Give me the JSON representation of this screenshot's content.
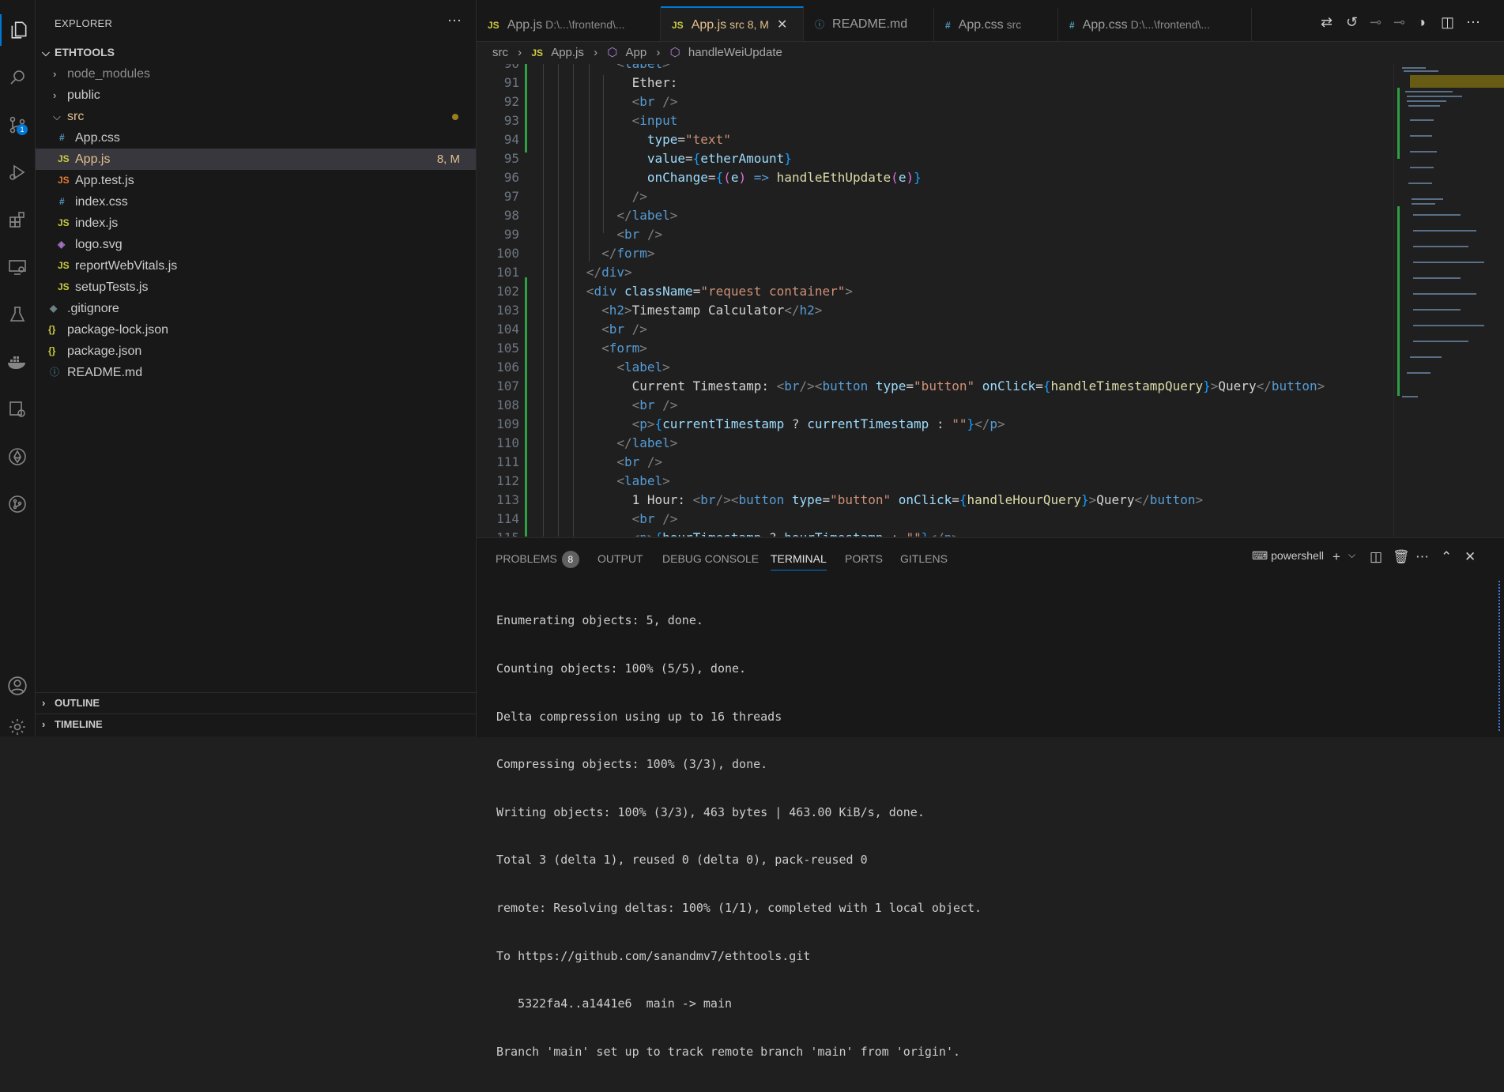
{
  "sidebar": {
    "title": "EXPLORER",
    "root": "ETHTOOLS",
    "items": [
      {
        "label": "node_modules",
        "type": "folder"
      },
      {
        "label": "public",
        "type": "folder"
      },
      {
        "label": "src",
        "type": "folder-open"
      },
      {
        "label": "App.css",
        "icon": "#",
        "type": "file"
      },
      {
        "label": "App.js",
        "icon": "JS",
        "type": "file",
        "decoration": "8, M"
      },
      {
        "label": "App.test.js",
        "icon": "JS",
        "type": "file"
      },
      {
        "label": "index.css",
        "icon": "#",
        "type": "file"
      },
      {
        "label": "index.js",
        "icon": "JS",
        "type": "file"
      },
      {
        "label": "logo.svg",
        "icon": "svg",
        "type": "file"
      },
      {
        "label": "reportWebVitals.js",
        "icon": "JS",
        "type": "file"
      },
      {
        "label": "setupTests.js",
        "icon": "JS",
        "type": "file"
      },
      {
        "label": ".gitignore",
        "icon": "git",
        "type": "file"
      },
      {
        "label": "package-lock.json",
        "icon": "{}",
        "type": "file"
      },
      {
        "label": "package.json",
        "icon": "{}",
        "type": "file"
      },
      {
        "label": "README.md",
        "icon": "i",
        "type": "file"
      }
    ],
    "outline": "OUTLINE",
    "timeline": "TIMELINE"
  },
  "activity": {
    "scm_badge": "1"
  },
  "tabs": [
    {
      "label": "App.js",
      "desc": "D:\\...\\frontend\\...",
      "icon": "JS"
    },
    {
      "label": "App.js",
      "desc": "src 8, M",
      "icon": "JS",
      "active": true
    },
    {
      "label": "README.md",
      "desc": "",
      "icon": "ⓘ"
    },
    {
      "label": "App.css",
      "desc": "src",
      "icon": "#"
    },
    {
      "label": "App.css",
      "desc": "D:\\...\\frontend\\...",
      "icon": "#"
    }
  ],
  "breadcrumb": {
    "p1": "src",
    "p2": "App.js",
    "p3": "App",
    "p4": "handleWeiUpdate"
  },
  "editor": {
    "line_numbers": [
      "90",
      "91",
      "92",
      "93",
      "94",
      "95",
      "96",
      "97",
      "98",
      "99",
      "100",
      "101",
      "102",
      "103",
      "104",
      "105",
      "106",
      "107",
      "108",
      "109",
      "110",
      "111",
      "112",
      "113",
      "114",
      "115"
    ]
  },
  "panel": {
    "tabs": {
      "problems": "PROBLEMS",
      "problems_count": "8",
      "output": "OUTPUT",
      "debug": "DEBUG CONSOLE",
      "terminal": "TERMINAL",
      "ports": "PORTS",
      "gitlens": "GITLENS"
    },
    "shell": "powershell",
    "terminal_lines": [
      "Enumerating objects: 5, done.",
      "Counting objects: 100% (5/5), done.",
      "Delta compression using up to 16 threads",
      "Compressing objects: 100% (3/3), done.",
      "Writing objects: 100% (3/3), 463 bytes | 463.00 KiB/s, done.",
      "Total 3 (delta 1), reused 0 (delta 0), pack-reused 0",
      "remote: Resolving deltas: 100% (1/1), completed with 1 local object.",
      "To https://github.com/sanandmv7/ethtools.git",
      "   5322fa4..a1441e6  main -> main",
      "Branch 'main' set up to track remote branch 'main' from 'origin'."
    ]
  }
}
